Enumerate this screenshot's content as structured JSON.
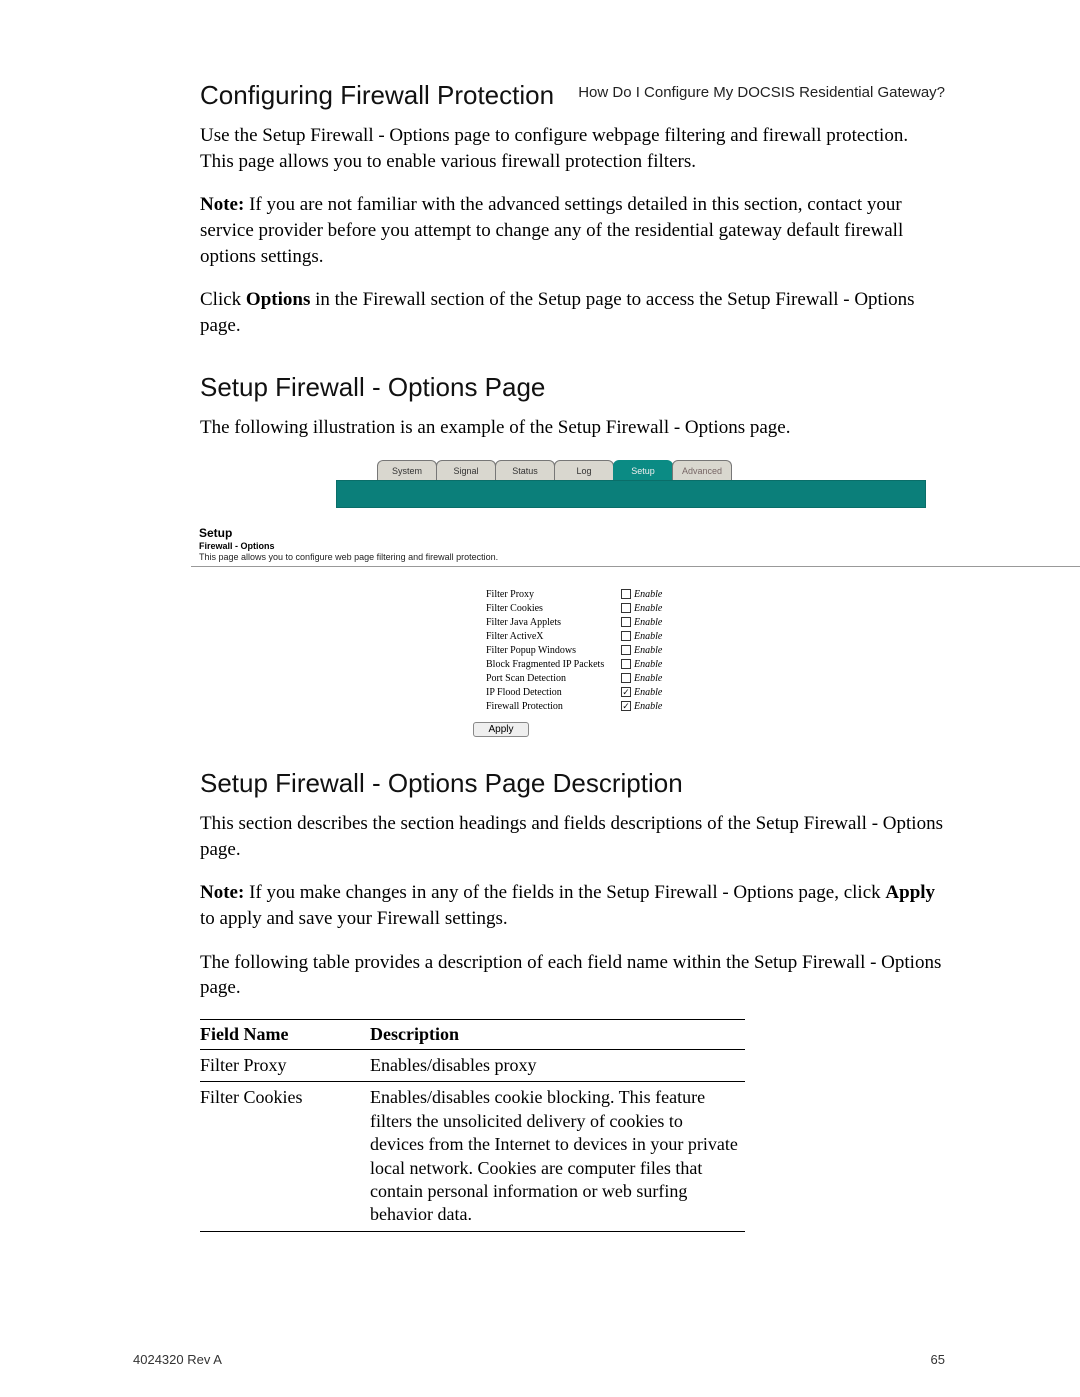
{
  "running_head": "How Do I Configure My DOCSIS Residential Gateway?",
  "h1": "Configuring Firewall Protection",
  "p1": "Use the Setup Firewall - Options page to configure webpage filtering and firewall protection. This page allows you to enable various firewall protection filters.",
  "p2_label": "Note:",
  "p2_rest": " If you are not familiar with the advanced settings detailed in this section, contact your service provider before you attempt to change any of the residential gateway default firewall options settings.",
  "p3_a": "Click ",
  "p3_b": "Options",
  "p3_c": " in the Firewall section of the Setup page to access the Setup Firewall - Options page.",
  "h2": "Setup Firewall - Options Page",
  "p4": "The following illustration is an example of the Setup Firewall - Options page.",
  "shot": {
    "tabs": [
      "System",
      "Signal",
      "Status",
      "Log",
      "Setup",
      "Advanced"
    ],
    "active_tab_index": 4,
    "title": "Setup",
    "sub": "Firewall - Options",
    "desc": "This page allows you to configure web page filtering and firewall protection.",
    "options": [
      {
        "label": "Filter Proxy",
        "checked": false
      },
      {
        "label": "Filter Cookies",
        "checked": false
      },
      {
        "label": "Filter Java Applets",
        "checked": false
      },
      {
        "label": "Filter ActiveX",
        "checked": false
      },
      {
        "label": "Filter Popup Windows",
        "checked": false
      },
      {
        "label": "Block Fragmented IP Packets",
        "checked": false
      },
      {
        "label": "Port Scan Detection",
        "checked": false
      },
      {
        "label": "IP Flood Detection",
        "checked": true
      },
      {
        "label": "Firewall Protection",
        "checked": true
      }
    ],
    "enable_word": "Enable",
    "apply_label": "Apply"
  },
  "h3": "Setup Firewall - Options Page Description",
  "p5": "This section describes the section headings and fields descriptions of the Setup Firewall - Options page.",
  "p6_label": "Note:",
  "p6_rest_a": " If you make changes in any of the fields in the Setup Firewall - Options page, click ",
  "p6_b": "Apply",
  "p6_rest_b": " to apply and save your Firewall settings.",
  "p7": "The following table provides a description of each field name within the Setup Firewall - Options page.",
  "table": {
    "head_name": "Field Name",
    "head_desc": "Description",
    "rows": [
      {
        "name": "Filter Proxy",
        "desc": "Enables/disables proxy"
      },
      {
        "name": "Filter Cookies",
        "desc": "Enables/disables cookie blocking. This feature filters the unsolicited delivery of cookies to devices from the Internet to devices in your private local network. Cookies are computer files that contain personal information or web surfing behavior data."
      }
    ]
  },
  "footer_left": "4024320 Rev A",
  "footer_right": "65"
}
